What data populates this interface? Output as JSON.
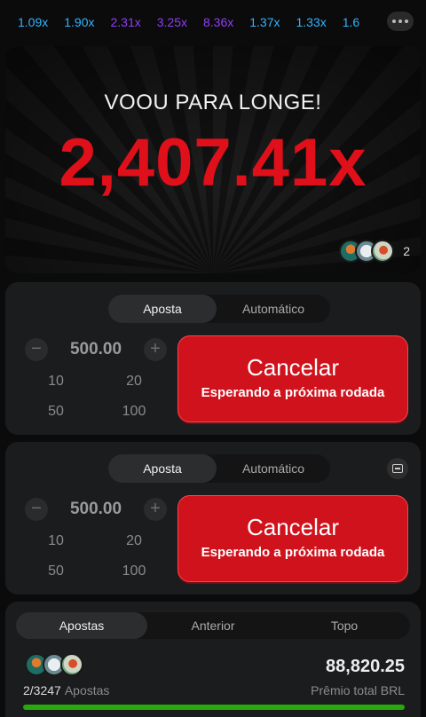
{
  "history": {
    "multipliers": [
      {
        "value": "1.09x",
        "color": "#34b4ff"
      },
      {
        "value": "1.90x",
        "color": "#34b4ff"
      },
      {
        "value": "2.31x",
        "color": "#913ef8"
      },
      {
        "value": "3.25x",
        "color": "#913ef8"
      },
      {
        "value": "8.36x",
        "color": "#913ef8"
      },
      {
        "value": "1.37x",
        "color": "#34b4ff"
      },
      {
        "value": "1.33x",
        "color": "#34b4ff"
      },
      {
        "value": "1.6",
        "color": "#34b4ff"
      }
    ],
    "more_icon": "ellipsis-icon"
  },
  "game": {
    "status_text": "VOOU PARA LONGE!",
    "multiplier": "2,407.41x",
    "multiplier_color": "#e0101b",
    "players_count": "2"
  },
  "bet_panels": [
    {
      "tabs": [
        "Aposta",
        "Automático"
      ],
      "active_tab": "Aposta",
      "amount": "500.00",
      "minus_label": "−",
      "plus_label": "+",
      "quick_amounts": [
        "10",
        "20",
        "50",
        "100"
      ],
      "cancel_label": "Cancelar",
      "cancel_sub": "Esperando a próxima rodada"
    },
    {
      "tabs": [
        "Aposta",
        "Automático"
      ],
      "active_tab": "Aposta",
      "amount": "500.00",
      "minus_label": "−",
      "plus_label": "+",
      "quick_amounts": [
        "10",
        "20",
        "50",
        "100"
      ],
      "cancel_label": "Cancelar",
      "cancel_sub": "Esperando a próxima rodada",
      "collapse_icon": "collapse-panel-icon"
    }
  ],
  "bets_list": {
    "tabs": [
      "Apostas",
      "Anterior",
      "Topo"
    ],
    "active_tab": "Apostas",
    "ratio": "2/3247",
    "ratio_label": "Apostas",
    "prize": "88,820.25",
    "prize_label": "Prêmio total BRL",
    "progress_fraction": 1.0,
    "progress_color": "#28a909"
  }
}
